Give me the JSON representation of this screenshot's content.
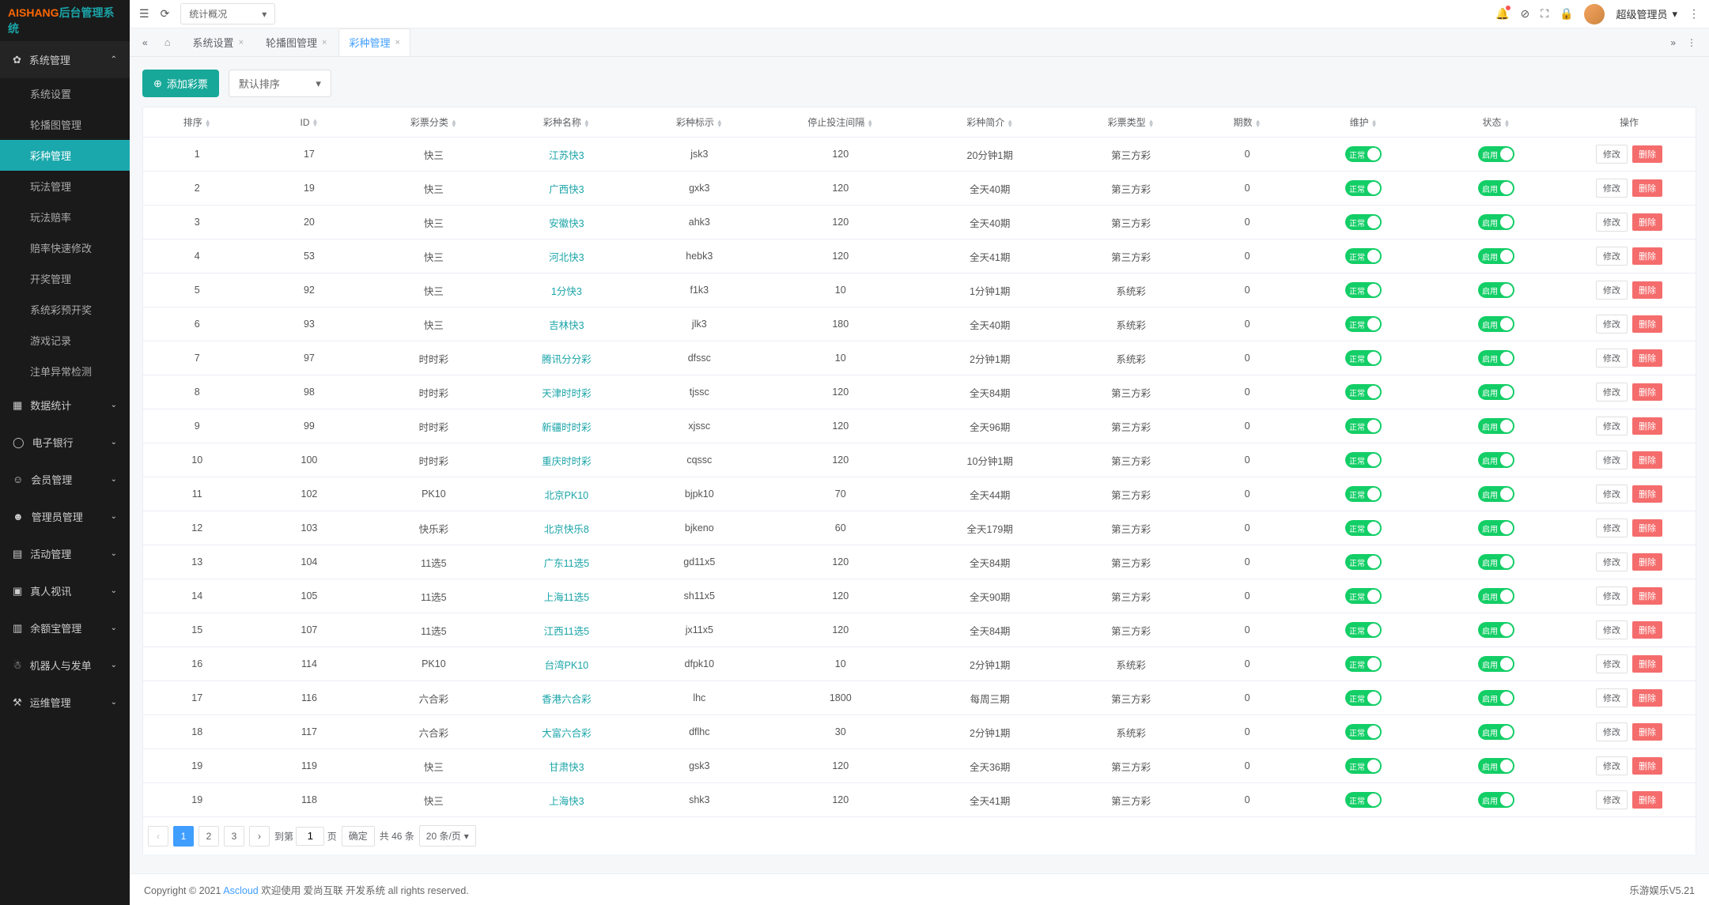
{
  "logo": {
    "part1": "AISHANG",
    "part2": "后台管理系统"
  },
  "top": {
    "select": "统计概况",
    "user": "超级管理员"
  },
  "sidebar": {
    "group0": {
      "title": "系统管理"
    },
    "items": [
      "系统设置",
      "轮播图管理",
      "彩种管理",
      "玩法管理",
      "玩法赔率",
      "赔率快速修改",
      "开奖管理",
      "系统彩预开奖",
      "游戏记录",
      "注单异常检测"
    ],
    "groups": [
      "数据统计",
      "电子银行",
      "会员管理",
      "管理员管理",
      "活动管理",
      "真人视讯",
      "余额宝管理",
      "机器人与发单",
      "运维管理"
    ]
  },
  "tabs": [
    {
      "label": "系统设置"
    },
    {
      "label": "轮播图管理"
    },
    {
      "label": "彩种管理",
      "active": true
    }
  ],
  "toolbar": {
    "add": "添加彩票",
    "sort": "默认排序"
  },
  "cols": [
    "排序",
    "ID",
    "彩票分类",
    "彩种名称",
    "彩种标示",
    "停止投注间隔",
    "彩种简介",
    "彩票类型",
    "期数",
    "维护",
    "状态",
    "操作"
  ],
  "toggles": {
    "maintain": "正常",
    "status": "启用"
  },
  "actions": {
    "edit": "修改",
    "del": "删除"
  },
  "rows": [
    {
      "sort": "1",
      "id": "17",
      "cat": "快三",
      "name": "江苏快3",
      "tag": "jsk3",
      "stop": "120",
      "intro": "20分钟1期",
      "type": "第三方彩",
      "periods": "0"
    },
    {
      "sort": "2",
      "id": "19",
      "cat": "快三",
      "name": "广西快3",
      "tag": "gxk3",
      "stop": "120",
      "intro": "全天40期",
      "type": "第三方彩",
      "periods": "0"
    },
    {
      "sort": "3",
      "id": "20",
      "cat": "快三",
      "name": "安徽快3",
      "tag": "ahk3",
      "stop": "120",
      "intro": "全天40期",
      "type": "第三方彩",
      "periods": "0"
    },
    {
      "sort": "4",
      "id": "53",
      "cat": "快三",
      "name": "河北快3",
      "tag": "hebk3",
      "stop": "120",
      "intro": "全天41期",
      "type": "第三方彩",
      "periods": "0"
    },
    {
      "sort": "5",
      "id": "92",
      "cat": "快三",
      "name": "1分快3",
      "tag": "f1k3",
      "stop": "10",
      "intro": "1分钟1期",
      "type": "系统彩",
      "periods": "0"
    },
    {
      "sort": "6",
      "id": "93",
      "cat": "快三",
      "name": "吉林快3",
      "tag": "jlk3",
      "stop": "180",
      "intro": "全天40期",
      "type": "系统彩",
      "periods": "0"
    },
    {
      "sort": "7",
      "id": "97",
      "cat": "时时彩",
      "name": "腾讯分分彩",
      "tag": "dfssc",
      "stop": "10",
      "intro": "2分钟1期",
      "type": "系统彩",
      "periods": "0"
    },
    {
      "sort": "8",
      "id": "98",
      "cat": "时时彩",
      "name": "天津时时彩",
      "tag": "tjssc",
      "stop": "120",
      "intro": "全天84期",
      "type": "第三方彩",
      "periods": "0"
    },
    {
      "sort": "9",
      "id": "99",
      "cat": "时时彩",
      "name": "新疆时时彩",
      "tag": "xjssc",
      "stop": "120",
      "intro": "全天96期",
      "type": "第三方彩",
      "periods": "0"
    },
    {
      "sort": "10",
      "id": "100",
      "cat": "时时彩",
      "name": "重庆时时彩",
      "tag": "cqssc",
      "stop": "120",
      "intro": "10分钟1期",
      "type": "第三方彩",
      "periods": "0"
    },
    {
      "sort": "11",
      "id": "102",
      "cat": "PK10",
      "name": "北京PK10",
      "tag": "bjpk10",
      "stop": "70",
      "intro": "全天44期",
      "type": "第三方彩",
      "periods": "0"
    },
    {
      "sort": "12",
      "id": "103",
      "cat": "快乐彩",
      "name": "北京快乐8",
      "tag": "bjkeno",
      "stop": "60",
      "intro": "全天179期",
      "type": "第三方彩",
      "periods": "0"
    },
    {
      "sort": "13",
      "id": "104",
      "cat": "11选5",
      "name": "广东11选5",
      "tag": "gd11x5",
      "stop": "120",
      "intro": "全天84期",
      "type": "第三方彩",
      "periods": "0"
    },
    {
      "sort": "14",
      "id": "105",
      "cat": "11选5",
      "name": "上海11选5",
      "tag": "sh11x5",
      "stop": "120",
      "intro": "全天90期",
      "type": "第三方彩",
      "periods": "0"
    },
    {
      "sort": "15",
      "id": "107",
      "cat": "11选5",
      "name": "江西11选5",
      "tag": "jx11x5",
      "stop": "120",
      "intro": "全天84期",
      "type": "第三方彩",
      "periods": "0"
    },
    {
      "sort": "16",
      "id": "114",
      "cat": "PK10",
      "name": "台湾PK10",
      "tag": "dfpk10",
      "stop": "10",
      "intro": "2分钟1期",
      "type": "系统彩",
      "periods": "0"
    },
    {
      "sort": "17",
      "id": "116",
      "cat": "六合彩",
      "name": "香港六合彩",
      "tag": "lhc",
      "stop": "1800",
      "intro": "每周三期",
      "type": "第三方彩",
      "periods": "0"
    },
    {
      "sort": "18",
      "id": "117",
      "cat": "六合彩",
      "name": "大富六合彩",
      "tag": "dflhc",
      "stop": "30",
      "intro": "2分钟1期",
      "type": "系统彩",
      "periods": "0"
    },
    {
      "sort": "19",
      "id": "119",
      "cat": "快三",
      "name": "甘肃快3",
      "tag": "gsk3",
      "stop": "120",
      "intro": "全天36期",
      "type": "第三方彩",
      "periods": "0"
    },
    {
      "sort": "19",
      "id": "118",
      "cat": "快三",
      "name": "上海快3",
      "tag": "shk3",
      "stop": "120",
      "intro": "全天41期",
      "type": "第三方彩",
      "periods": "0"
    }
  ],
  "pager": {
    "pages": [
      "1",
      "2",
      "3"
    ],
    "goto_label": "到第",
    "page_unit": "页",
    "confirm": "确定",
    "total": "共 46 条",
    "size": "20 条/页",
    "jump_value": "1"
  },
  "footer": {
    "left1": "Copyright © 2021 ",
    "asc": "Ascloud",
    "left2": " 欢迎使用 爱尚互联 开发系统 all rights reserved.",
    "right": "乐游娱乐V5.21"
  }
}
